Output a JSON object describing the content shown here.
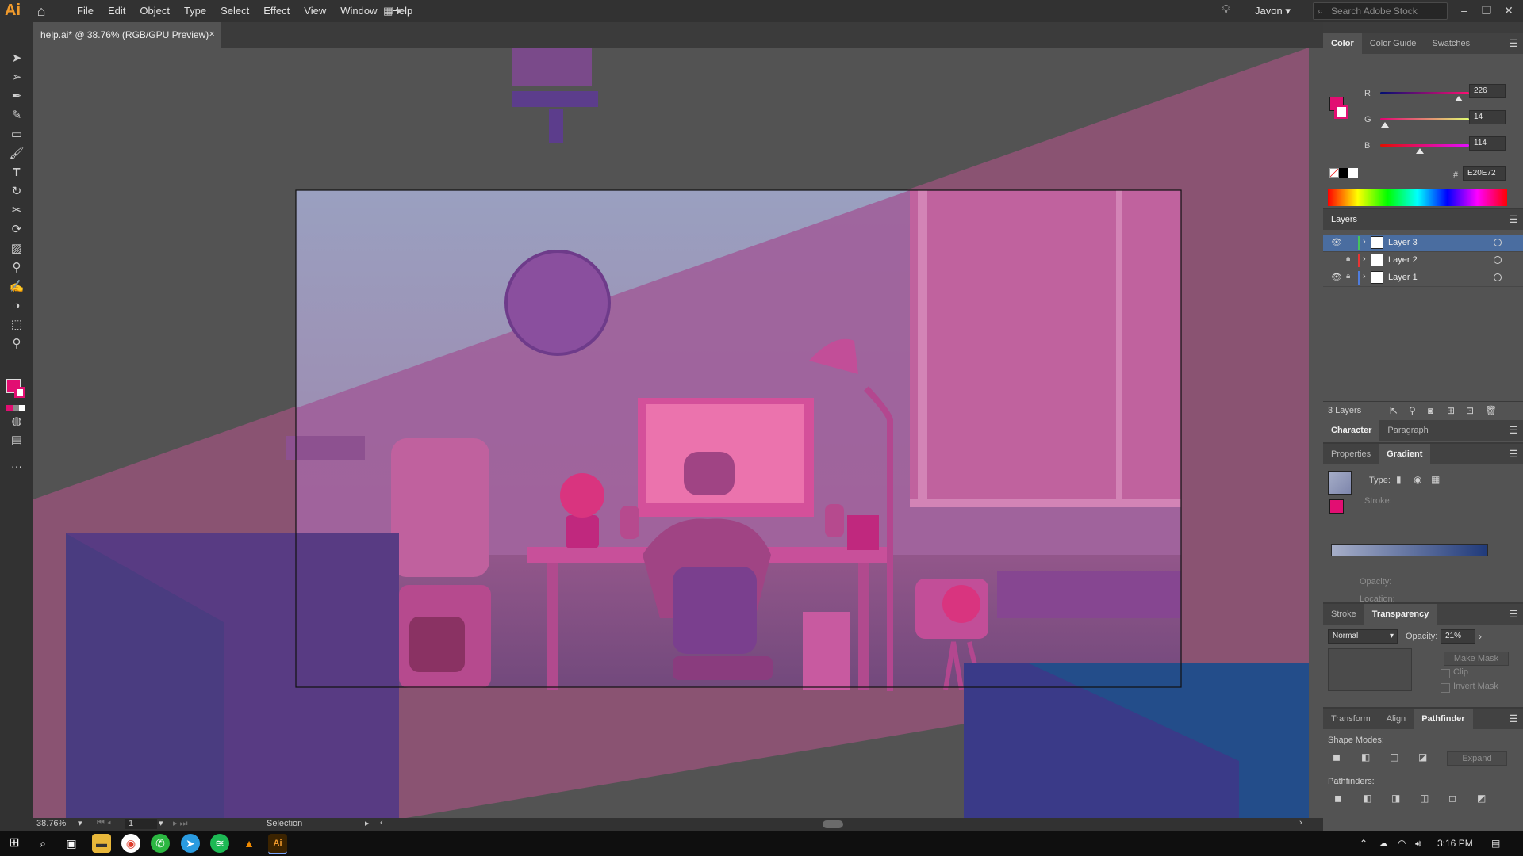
{
  "app": {
    "logo": "Ai",
    "home_icon": "home-icon"
  },
  "menu": [
    "File",
    "Edit",
    "Object",
    "Type",
    "Select",
    "Effect",
    "View",
    "Window",
    "Help"
  ],
  "workspace_user": "Javon",
  "search_stock": {
    "placeholder": "Search Adobe Stock"
  },
  "document_tab": {
    "title": "help.ai* @ 38.76% (RGB/GPU Preview)",
    "close": "×"
  },
  "tools": [
    "selection-tool-icon",
    "direct-selection-tool-icon",
    "pen-tool-icon",
    "curvature-tool-icon",
    "rectangle-tool-icon",
    "paintbrush-tool-icon",
    "type-tool-icon",
    "rotate-tool-icon",
    "scissors-tool-icon",
    "puppet-warp-tool-icon",
    "gradient-tool-icon",
    "eyedropper-tool-icon",
    "shaper-tool-icon",
    "shape-builder-tool-icon",
    "artboard-tool-icon",
    "zoom-tool-icon"
  ],
  "color_panel": {
    "tabs": [
      "Color",
      "Color Guide",
      "Swatches"
    ],
    "r_label": "R",
    "r_value": "226",
    "r": 226,
    "g_label": "G",
    "g_value": "14",
    "g": 14,
    "b_label": "B",
    "b_value": "114",
    "b": 114,
    "hex_label": "#",
    "hex": "E20E72",
    "fill_color": "#e20e72"
  },
  "layers_panel": {
    "title": "Layers",
    "layers": [
      {
        "name": "Layer 3",
        "color": "#47c35b",
        "visible": true,
        "locked": false,
        "selected": true
      },
      {
        "name": "Layer 2",
        "color": "#e83434",
        "visible": false,
        "locked": true,
        "selected": false
      },
      {
        "name": "Layer 1",
        "color": "#4f7dde",
        "visible": true,
        "locked": true,
        "selected": false
      }
    ],
    "count": "3 Layers"
  },
  "character_panel": {
    "tabs": [
      "Character",
      "Paragraph"
    ]
  },
  "gradient_panel": {
    "tabs": [
      "Properties",
      "Gradient"
    ],
    "type_label": "Type:",
    "stroke_label": "Stroke:",
    "opacity_label": "Opacity:",
    "location_label": "Location:",
    "gradient_start": "#a6aec8",
    "gradient_end": "#203a7a"
  },
  "transparency_panel": {
    "tabs": [
      "Stroke",
      "Transparency"
    ],
    "blend_mode": "Normal",
    "opacity_label": "Opacity:",
    "opacity": "21%",
    "make_mask": "Make Mask",
    "clip": "Clip",
    "invert_mask": "Invert Mask"
  },
  "pathfinder_panel": {
    "tabs": [
      "Transform",
      "Align",
      "Pathfinder"
    ],
    "shape_modes": "Shape Modes:",
    "expand": "Expand",
    "pathfinders": "Pathfinders:"
  },
  "status": {
    "zoom": "38.76%",
    "artboard": "1",
    "tool": "Selection"
  },
  "taskbar": {
    "time": "3:16 PM"
  }
}
